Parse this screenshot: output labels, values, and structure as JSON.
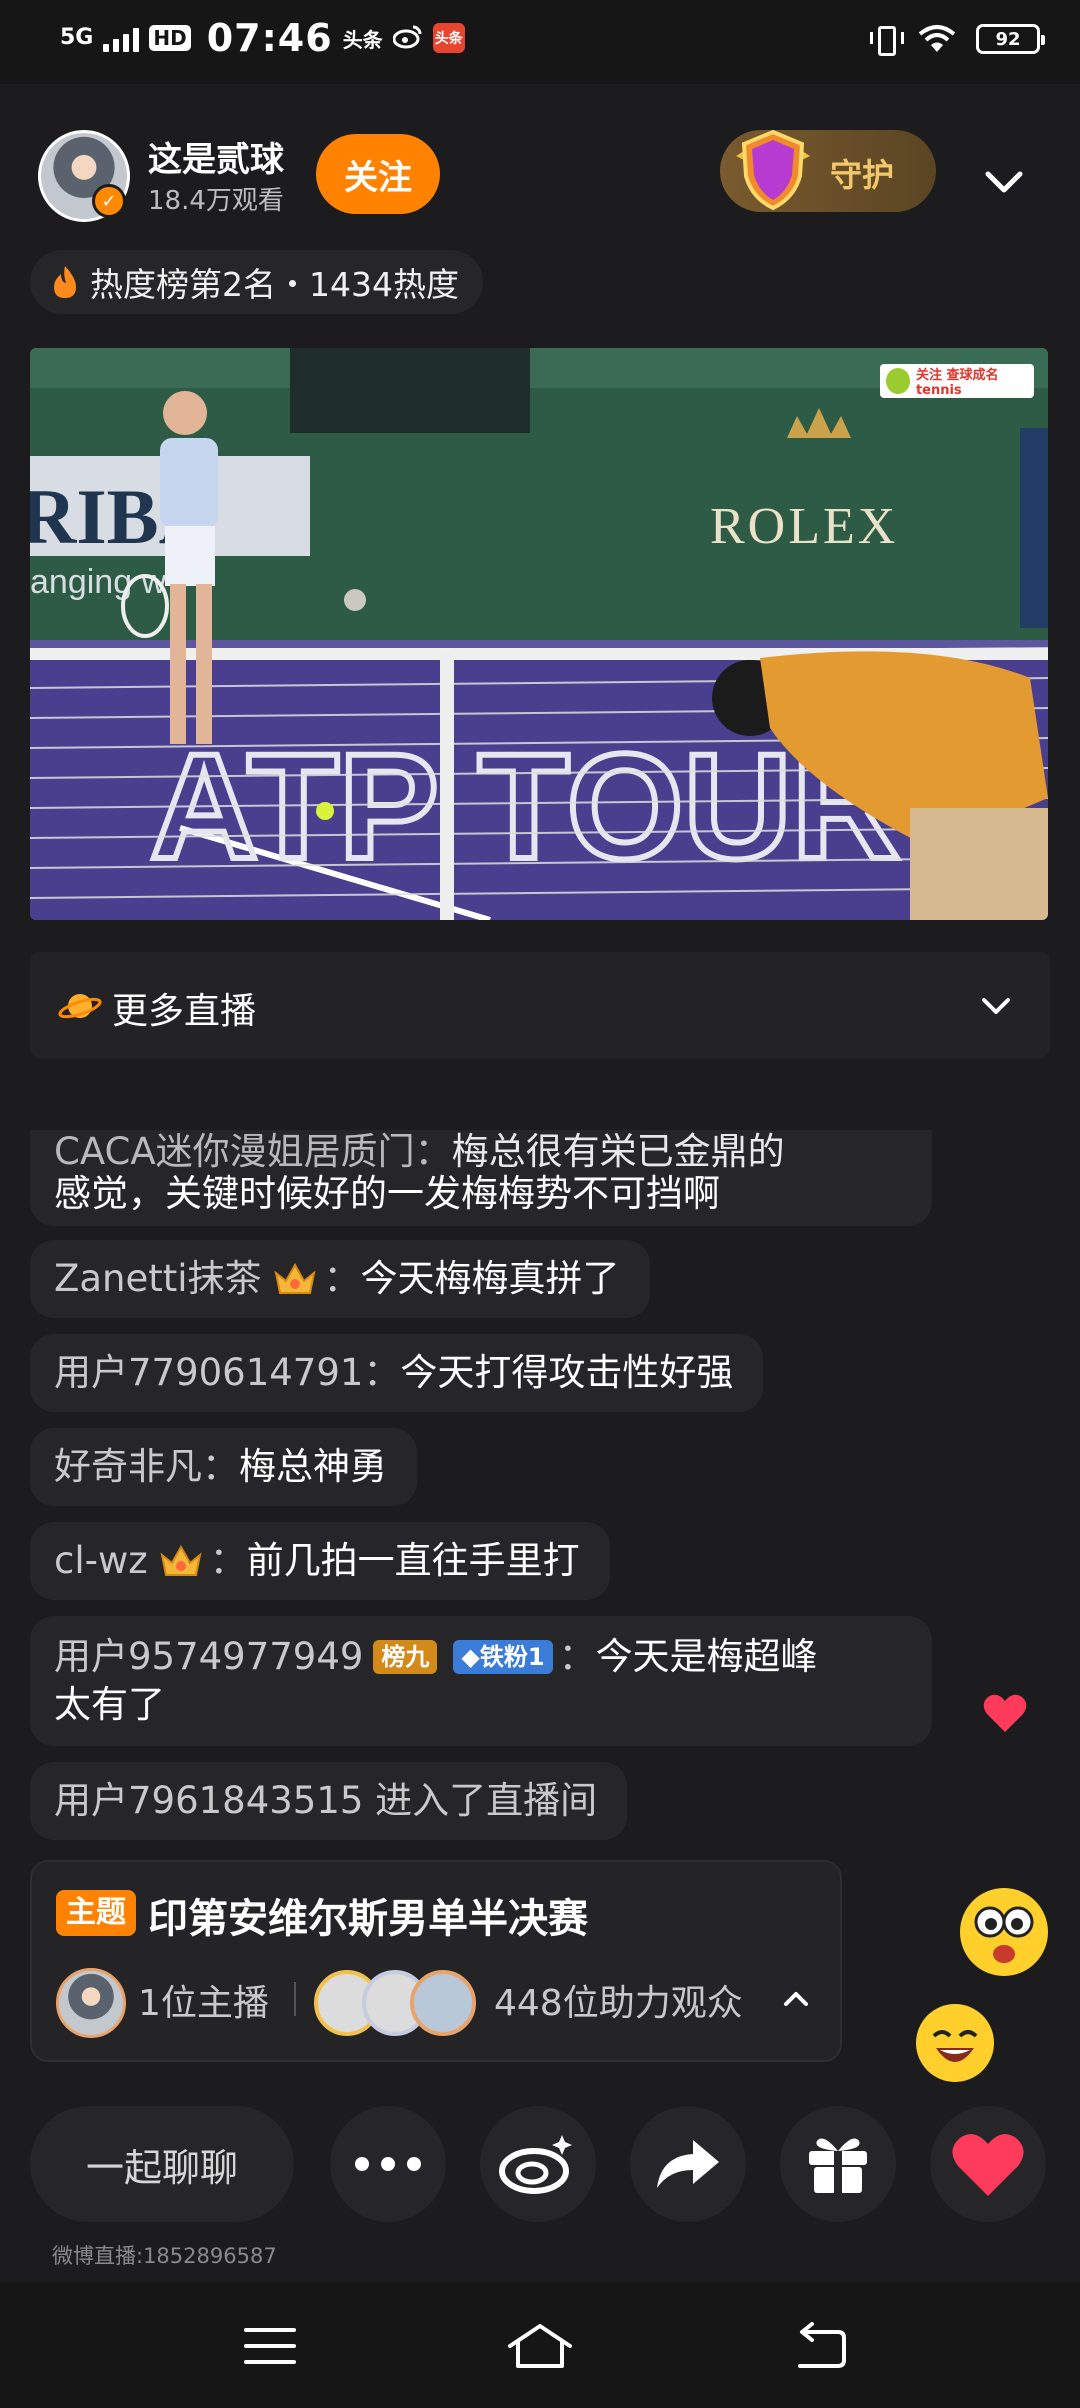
{
  "status_bar": {
    "network": "5G",
    "hd": "HD",
    "time": "07:46",
    "mini_icon_1": "头条",
    "app_icon": "头条",
    "battery": "92"
  },
  "header": {
    "host_name": "这是贰球",
    "views": "18.4万观看",
    "follow_label": "关注",
    "guard_label": "守护",
    "guard_shield_char": "守",
    "heat_text": "热度榜第2名・1434热度"
  },
  "video": {
    "watermark": "关注 查球成名tennis"
  },
  "more_live": {
    "label": "更多直播"
  },
  "chat": {
    "messages": [
      {
        "user": "CACA迷你漫姐居质门：",
        "text": "梅总很有栄已金鼎的"
      },
      {
        "user": "",
        "text": "感觉，关键时候好的一发梅梅势不可挡啊"
      },
      {
        "user": "Zanetti抹茶",
        "sep": "：",
        "text": "今天梅梅真拼了"
      },
      {
        "user": "用户7790614791：",
        "text": "今天打得攻击性好强"
      },
      {
        "user": "好奇非凡：",
        "text": "梅总神勇"
      },
      {
        "user": "cl-wz",
        "sep": "：",
        "text": "前几拍一直往手里打"
      },
      {
        "user": "用户9574977949",
        "badge1": "榜九",
        "badge2": "◆铁粉1",
        "sep": "：",
        "text": "今天是梅超峰",
        "text2": "太有了"
      },
      {
        "user": "用户7961843515 进入了直播间",
        "text": ""
      }
    ]
  },
  "topic": {
    "tag": "主题",
    "title": "印第安维尔斯男单半决赛",
    "hosts": "1位主播",
    "fans": "448位助力观众"
  },
  "bottom_bar": {
    "chat_label": "一起聊聊",
    "room_id": "微博直播:1852896587"
  },
  "colors": {
    "accent_orange": "#ff8200",
    "background": "#1c1c1e",
    "bubble": "#262628",
    "like_red": "#ff3b5c"
  },
  "icons": [
    "signal-icon",
    "vibrate-icon",
    "wifi-icon",
    "battery-icon",
    "verified-icon",
    "guard-shield-icon",
    "chevron-down-icon",
    "flame-icon",
    "planet-icon",
    "crown-icon",
    "heart-icon",
    "more-icon",
    "weibo-icon",
    "share-icon",
    "gift-icon",
    "menu-icon",
    "home-icon",
    "back-icon"
  ]
}
